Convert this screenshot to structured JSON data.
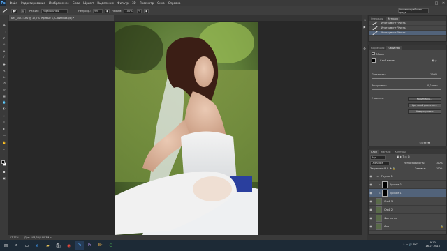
{
  "menu": {
    "logo": "Ps",
    "items": [
      "Файл",
      "Редактирование",
      "Изображение",
      "Слои",
      "Шрифт",
      "Выделение",
      "Фильтр",
      "3D",
      "Просмотр",
      "Окно",
      "Справка"
    ]
  },
  "options": {
    "mode_label": "Режим:",
    "mode_value": "Нормальный",
    "opacity_label": "Непрозр.:",
    "opacity_value": "9%",
    "press_label": "Нажим:",
    "press_value": "100%",
    "workspace": "Основная рабочая среда"
  },
  "document": {
    "tab_title": "Без_1072.CR2 @ 17,7% (Кривые 1, Слой-маска/8) *"
  },
  "status": {
    "zoom": "17,77%",
    "doc_size": "Док: 103,3М/190,3М"
  },
  "history_panel": {
    "tabs": [
      "Операции",
      "История"
    ],
    "active_tab": 1,
    "items": [
      {
        "label": "Инструмент \"Кисть\"",
        "selected": false
      },
      {
        "label": "Инструмент \"Кисть\"",
        "selected": false
      },
      {
        "label": "Инструмент \"Кисть\"",
        "selected": true
      }
    ]
  },
  "properties_panel": {
    "tabs": [
      "Коррекция",
      "Свойства"
    ],
    "active_tab": 1,
    "title": "Маски",
    "mask_label": "Слой-маска",
    "density_label": "Плотность:",
    "density_value": "100%",
    "feather_label": "Растушевка:",
    "feather_value": "0,0 пикс.",
    "refine_label": "Уточнить:",
    "btn_edge": "Край маски...",
    "btn_color": "Цветовой диапазон...",
    "btn_invert": "Инвертировать"
  },
  "layers_panel": {
    "tabs": [
      "Слои",
      "Каналы",
      "Контуры"
    ],
    "active_tab": 0,
    "filter_label": "Вид",
    "blend_mode": "Обычные",
    "opacity_label": "Непрозрачность:",
    "opacity_value": "100%",
    "lock_label": "Закрепить:",
    "fill_label": "Заливка:",
    "fill_value": "100%",
    "layers": [
      {
        "name": "Группа 1",
        "type": "group",
        "selected": false,
        "thumb": "#555555"
      },
      {
        "name": "Кривые 2",
        "type": "adjust",
        "selected": false,
        "thumb": "#6a6a6a"
      },
      {
        "name": "Кривые 1",
        "type": "adjust",
        "selected": true,
        "thumb": "#6a6a6a"
      },
      {
        "name": "Слой 3",
        "type": "pixel",
        "selected": false,
        "thumb": "#5a6b4a"
      },
      {
        "name": "Слой 2",
        "type": "pixel",
        "selected": false,
        "thumb": "#5a6b4a"
      },
      {
        "name": "Фон копия",
        "type": "pixel",
        "selected": false,
        "thumb": "#5a6b4a"
      },
      {
        "name": "Фон",
        "type": "pixel",
        "selected": false,
        "thumb": "#5a6b4a"
      }
    ]
  },
  "taskbar": {
    "time": "9:10",
    "date": "16.07.2015",
    "lang": "РУС",
    "apps": [
      "windows-icon",
      "search-icon",
      "task-view-icon",
      "edge-icon",
      "explorer-icon",
      "store-icon",
      "chrome-icon",
      "photoshop-icon",
      "premiere-icon",
      "bridge-icon",
      "camtasia-icon"
    ]
  },
  "colors": {
    "accent_selection": "#52637a",
    "taskbar": "#1d2a36"
  }
}
